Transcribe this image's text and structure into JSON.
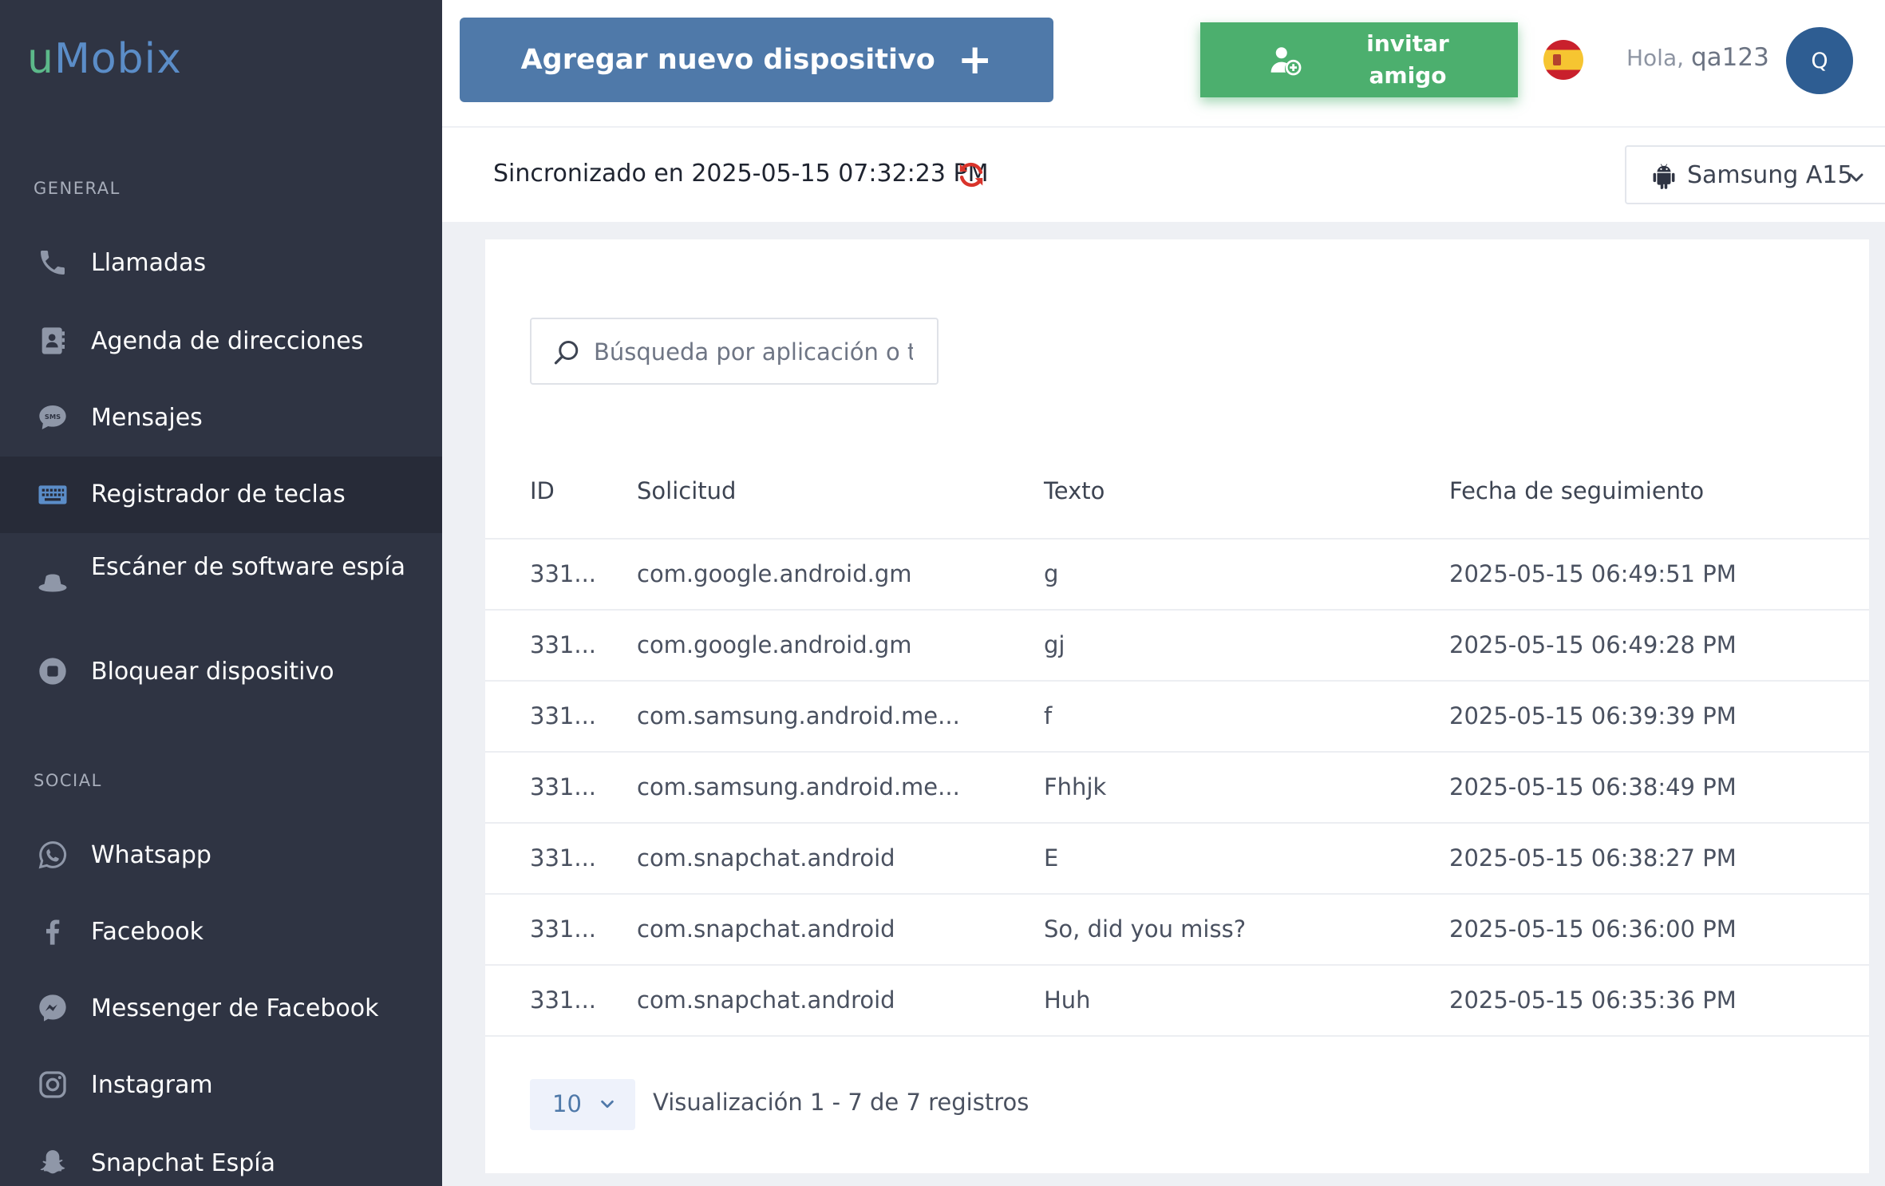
{
  "app": {
    "logo_u": "u",
    "logo_rest": "Mobix",
    "colors": {
      "sidebar_bg": "#2f3443",
      "primary": "#4f79a9",
      "success": "#4caf6e",
      "sync_red": "#d9342b"
    }
  },
  "sidebar": {
    "general_label": "GENERAL",
    "social_label": "SOCIAL",
    "general_items": [
      {
        "label": "Llamadas",
        "icon": "phone-icon"
      },
      {
        "label": "Agenda de direcciones",
        "icon": "address-book-icon"
      },
      {
        "label": "Mensajes",
        "icon": "sms-icon"
      },
      {
        "label": "Registrador de teclas",
        "icon": "keyboard-icon",
        "active": true
      },
      {
        "label": "Escáner de software espía",
        "icon": "spy-hat-icon"
      },
      {
        "label": "Bloquear dispositivo",
        "icon": "stop-icon"
      }
    ],
    "social_items": [
      {
        "label": "Whatsapp",
        "icon": "whatsapp-icon"
      },
      {
        "label": "Facebook",
        "icon": "facebook-icon"
      },
      {
        "label": "Messenger de Facebook",
        "icon": "messenger-icon"
      },
      {
        "label": "Instagram",
        "icon": "instagram-icon"
      },
      {
        "label": "Snapchat Espía",
        "icon": "snapchat-icon"
      }
    ]
  },
  "header": {
    "add_device_label": "Agregar nuevo dispositivo",
    "add_device_plus": "+",
    "invite_line1": "invitar",
    "invite_line2": "amigo",
    "greeting": "Hola,",
    "username": "qa123",
    "avatar_initial": "Q",
    "language_flag": "spain-flag-icon"
  },
  "sync": {
    "text": "Sincronizado en 2025-05-15 07:32:23 PM",
    "device": "Samsung A15"
  },
  "search": {
    "placeholder": "Búsqueda por aplicación o t"
  },
  "table": {
    "headers": {
      "id": "ID",
      "app": "Solicitud",
      "text": "Texto",
      "date": "Fecha de seguimiento"
    },
    "rows": [
      {
        "id": "331...",
        "app": "com.google.android.gm",
        "text": "g",
        "date": "2025-05-15 06:49:51 PM"
      },
      {
        "id": "331...",
        "app": "com.google.android.gm",
        "text": "gj",
        "date": "2025-05-15 06:49:28 PM"
      },
      {
        "id": "331...",
        "app": "com.samsung.android.me...",
        "text": "f",
        "date": "2025-05-15 06:39:39 PM"
      },
      {
        "id": "331...",
        "app": "com.samsung.android.me...",
        "text": "Fhhjk",
        "date": "2025-05-15 06:38:49 PM"
      },
      {
        "id": "331...",
        "app": "com.snapchat.android",
        "text": "E",
        "date": "2025-05-15 06:38:27 PM"
      },
      {
        "id": "331...",
        "app": "com.snapchat.android",
        "text": "So, did you miss?",
        "date": "2025-05-15 06:36:00 PM"
      },
      {
        "id": "331...",
        "app": "com.snapchat.android",
        "text": "Huh",
        "date": "2025-05-15 06:35:36 PM"
      }
    ]
  },
  "pagination": {
    "page_size": "10",
    "info": "Visualización 1 - 7 de 7 registros"
  }
}
